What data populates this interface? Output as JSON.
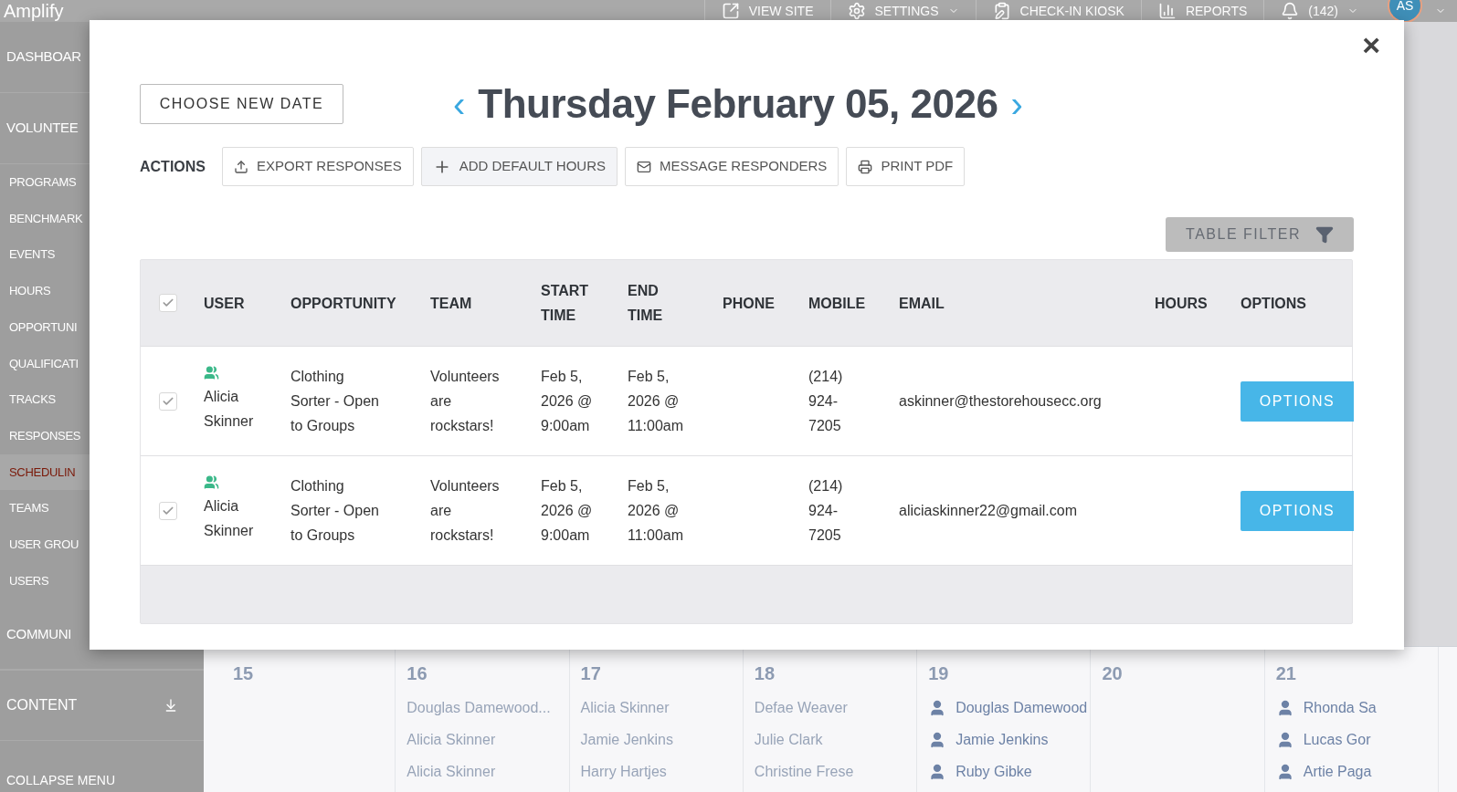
{
  "topbar": {
    "logo": "Amplify",
    "nav": [
      {
        "kind": "view",
        "label": "VIEW SITE"
      },
      {
        "kind": "settings",
        "label": "SETTINGS"
      },
      {
        "kind": "kiosk",
        "label": "CHECK-IN KIOSK"
      },
      {
        "kind": "reports",
        "label": "REPORTS"
      },
      {
        "kind": "bell",
        "label": "(142)"
      }
    ],
    "avatar": "AS"
  },
  "sidebar": {
    "items": [
      {
        "kind": "section",
        "label": "DASHBOAR",
        "selected": false
      },
      {
        "kind": "section",
        "label": "VOLUNTEE",
        "selected": false
      },
      {
        "kind": "sub",
        "label": "PROGRAMS",
        "selected": false
      },
      {
        "kind": "sub",
        "label": "BENCHMARK",
        "selected": false
      },
      {
        "kind": "sub",
        "label": "EVENTS",
        "selected": false
      },
      {
        "kind": "sub",
        "label": "HOURS",
        "selected": false
      },
      {
        "kind": "sub",
        "label": "OPPORTUNI",
        "selected": false
      },
      {
        "kind": "sub",
        "label": "QUALIFICATI",
        "selected": false
      },
      {
        "kind": "sub",
        "label": "TRACKS",
        "selected": false
      },
      {
        "kind": "sub",
        "label": "RESPONSES",
        "selected": false
      },
      {
        "kind": "sub",
        "label": "SCHEDULIN",
        "selected": true
      },
      {
        "kind": "sub",
        "label": "TEAMS",
        "selected": false
      },
      {
        "kind": "sub",
        "label": "USER GROU",
        "selected": false
      },
      {
        "kind": "sub",
        "label": "USERS",
        "selected": false
      },
      {
        "kind": "section",
        "label": "COMMUNI",
        "selected": false
      },
      {
        "kind": "content",
        "label": "CONTENT",
        "selected": false
      },
      {
        "kind": "footer",
        "label": "COLLAPSE MENU",
        "selected": false
      }
    ]
  },
  "calendar": {
    "days": [
      {
        "day": "15"
      },
      {
        "day": "16",
        "entries": [
          {
            "kind": "plain",
            "name": "Douglas Damewood..."
          },
          {
            "kind": "plain",
            "name": "Alicia Skinner"
          },
          {
            "kind": "plain",
            "name": "Alicia Skinner"
          }
        ]
      },
      {
        "day": "17",
        "entries": [
          {
            "kind": "plain",
            "name": "Alicia Skinner"
          },
          {
            "kind": "plain",
            "name": "Jamie Jenkins"
          },
          {
            "kind": "plain",
            "name": "Harry Hartjes"
          }
        ]
      },
      {
        "day": "18",
        "entries": [
          {
            "kind": "plain",
            "name": "Defae Weaver"
          },
          {
            "kind": "plain",
            "name": "Julie Clark"
          },
          {
            "kind": "plain",
            "name": "Christine Frese"
          }
        ]
      },
      {
        "day": "19",
        "entries": [
          {
            "kind": "person",
            "name": "Douglas Damewood"
          },
          {
            "kind": "person",
            "name": "Jamie Jenkins"
          },
          {
            "kind": "person",
            "name": "Ruby Gibke"
          }
        ]
      },
      {
        "day": "20"
      },
      {
        "day": "21",
        "entries": [
          {
            "kind": "person",
            "name": "Rhonda Sa"
          },
          {
            "kind": "person",
            "name": "Lucas Gor"
          },
          {
            "kind": "person",
            "name": "Artie Paga"
          }
        ]
      }
    ]
  },
  "modal": {
    "close": "×",
    "choose_date": "CHOOSE NEW DATE",
    "prev": "‹",
    "title": "Thursday February 05, 2026",
    "next": "›",
    "actions_label": "ACTIONS",
    "actions": [
      {
        "kind": "export",
        "label": "EXPORT RESPONSES",
        "selected": false
      },
      {
        "kind": "add",
        "label": "ADD DEFAULT HOURS",
        "selected": true
      },
      {
        "kind": "message",
        "label": "MESSAGE RESPONDERS",
        "selected": false
      },
      {
        "kind": "print",
        "label": "PRINT PDF",
        "selected": false
      }
    ],
    "table_filter": "TABLE FILTER",
    "table": {
      "select_all_checked": true,
      "columns": [
        [
          "USER"
        ],
        [
          "OPPORTUNITY"
        ],
        [
          "TEAM"
        ],
        [
          "START",
          "TIME"
        ],
        [
          "END",
          "TIME"
        ],
        [
          "PHONE"
        ],
        [
          "MOBILE"
        ],
        [
          "EMAIL"
        ],
        [
          "HOURS"
        ],
        [
          "OPTIONS"
        ]
      ],
      "rows": [
        {
          "checked": true,
          "user": [
            "Alicia",
            "Skinner"
          ],
          "opportunity": [
            "Clothing",
            "Sorter - Open",
            "to Groups"
          ],
          "team": [
            "Volunteers",
            "are",
            "rockstars!"
          ],
          "start": [
            "Feb 5,",
            "2026 @",
            "9:00am"
          ],
          "end": [
            "Feb 5,",
            "2026 @",
            "11:00am"
          ],
          "mobile": [
            "(214)",
            "924-",
            "7205"
          ],
          "email": "askinner@thestorehousecc.org",
          "options": "OPTIONS"
        },
        {
          "checked": true,
          "user": [
            "Alicia",
            "Skinner"
          ],
          "opportunity": [
            "Clothing",
            "Sorter - Open",
            "to Groups"
          ],
          "team": [
            "Volunteers",
            "are",
            "rockstars!"
          ],
          "start": [
            "Feb 5,",
            "2026 @",
            "9:00am"
          ],
          "end": [
            "Feb 5,",
            "2026 @",
            "11:00am"
          ],
          "mobile": [
            "(214)",
            "924-",
            "7205"
          ],
          "email": "aliciaskinner22@gmail.com",
          "options": "OPTIONS"
        }
      ]
    }
  }
}
